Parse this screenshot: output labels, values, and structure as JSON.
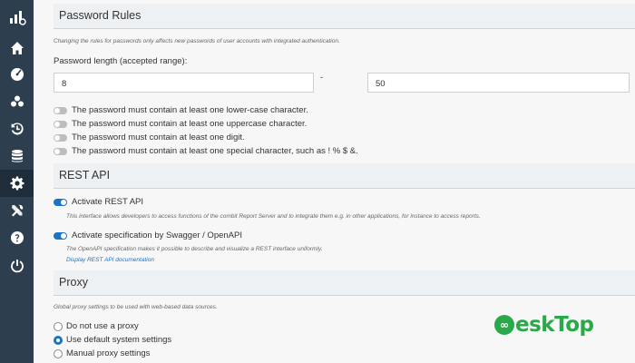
{
  "sections": {
    "password": {
      "title": "Password Rules",
      "note": "Changing the rules for passwords only affects new passwords of user accounts with integrated authentication.",
      "length_label": "Password length (accepted range):",
      "min_value": "8",
      "separator": "-",
      "max_value": "50",
      "rules": [
        {
          "label": "The password must contain at least one lower-case character.",
          "enabled": false
        },
        {
          "label": "The password must contain at least one uppercase character.",
          "enabled": false
        },
        {
          "label": "The password must contain at least one digit.",
          "enabled": false
        },
        {
          "label": "The password must contain at least one special character, such as ! % $ &.",
          "enabled": false
        }
      ]
    },
    "rest": {
      "title": "REST API",
      "activate_label": "Activate REST API",
      "activate_enabled": true,
      "activate_note": "This interface allows developers to access functions of the combit Report Server and to integrate them e.g. in other applications, for instance to access reports.",
      "swagger_label": "Activate specification by Swagger / OpenAPI",
      "swagger_enabled": true,
      "swagger_note": "The OpenAPI specification makes it possible to describe and visualize a REST interface uniformly.",
      "doc_link": "Display REST API documentation"
    },
    "proxy": {
      "title": "Proxy",
      "note": "Global proxy settings to be used with web-based data sources.",
      "options": [
        {
          "label": "Do not use a proxy",
          "checked": false
        },
        {
          "label": "Use default system settings",
          "checked": true
        },
        {
          "label": "Manual proxy settings",
          "checked": false
        }
      ]
    }
  },
  "sidebar": {
    "items": [
      "home-icon",
      "dashboard-icon",
      "users-icon",
      "history-icon",
      "database-icon",
      "settings-icon",
      "tools-icon",
      "help-icon",
      "power-icon"
    ],
    "active": "settings-icon"
  },
  "watermark": {
    "glyph": "∞",
    "text": "eskTop"
  },
  "colors": {
    "sidebar": "#2d3e4f",
    "accent": "#1a73c4",
    "watermark": "#2aa84a"
  }
}
